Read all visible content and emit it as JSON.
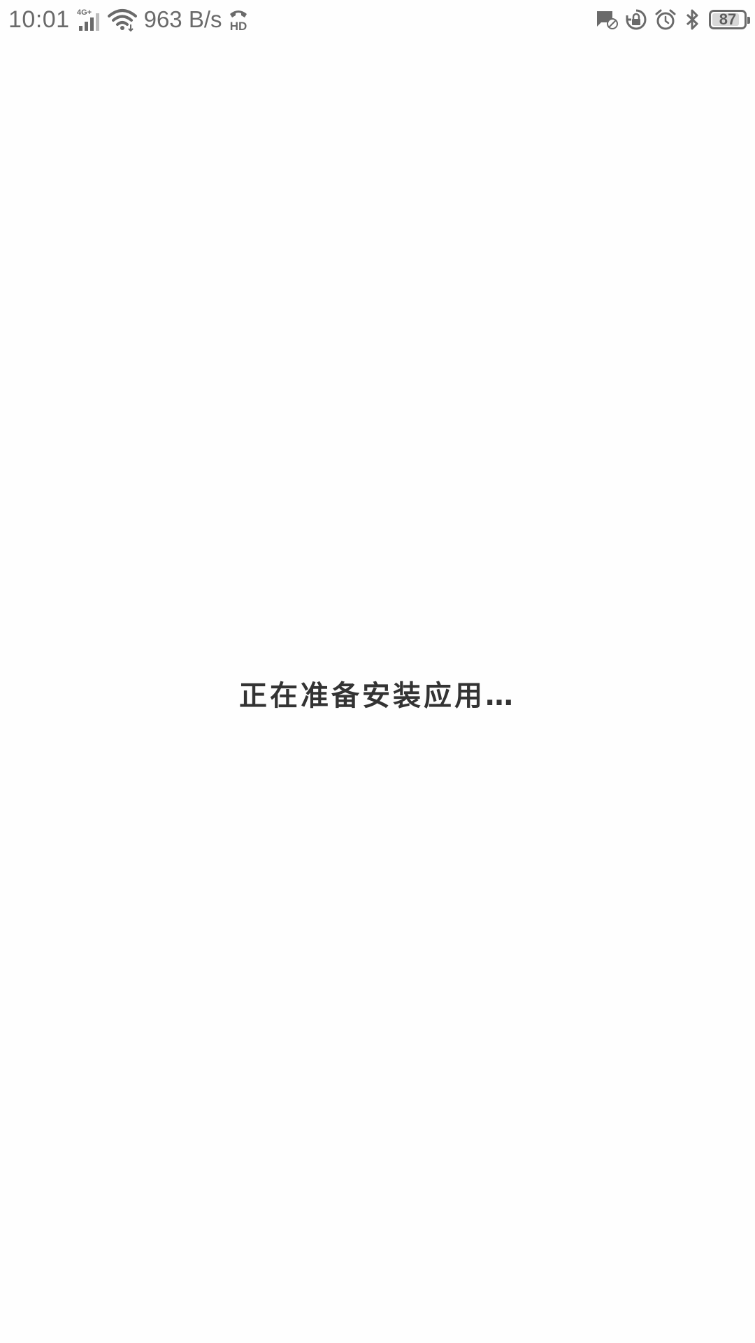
{
  "status_bar": {
    "time": "10:01",
    "network_type": "4G+",
    "net_speed": "963 B/s",
    "hd_label": "HD",
    "battery_level": "87",
    "battery_fraction": 0.87,
    "icons": [
      "signal-icon",
      "wifi-icon",
      "hd-call-icon",
      "message-blocked-icon",
      "lock-rotation-icon",
      "alarm-icon",
      "bluetooth-icon",
      "battery-icon"
    ],
    "icon_color": "#6a6a6a"
  },
  "main": {
    "message": "正在准备安装应用…",
    "text_color": "#333333",
    "background": "#fefefe"
  }
}
